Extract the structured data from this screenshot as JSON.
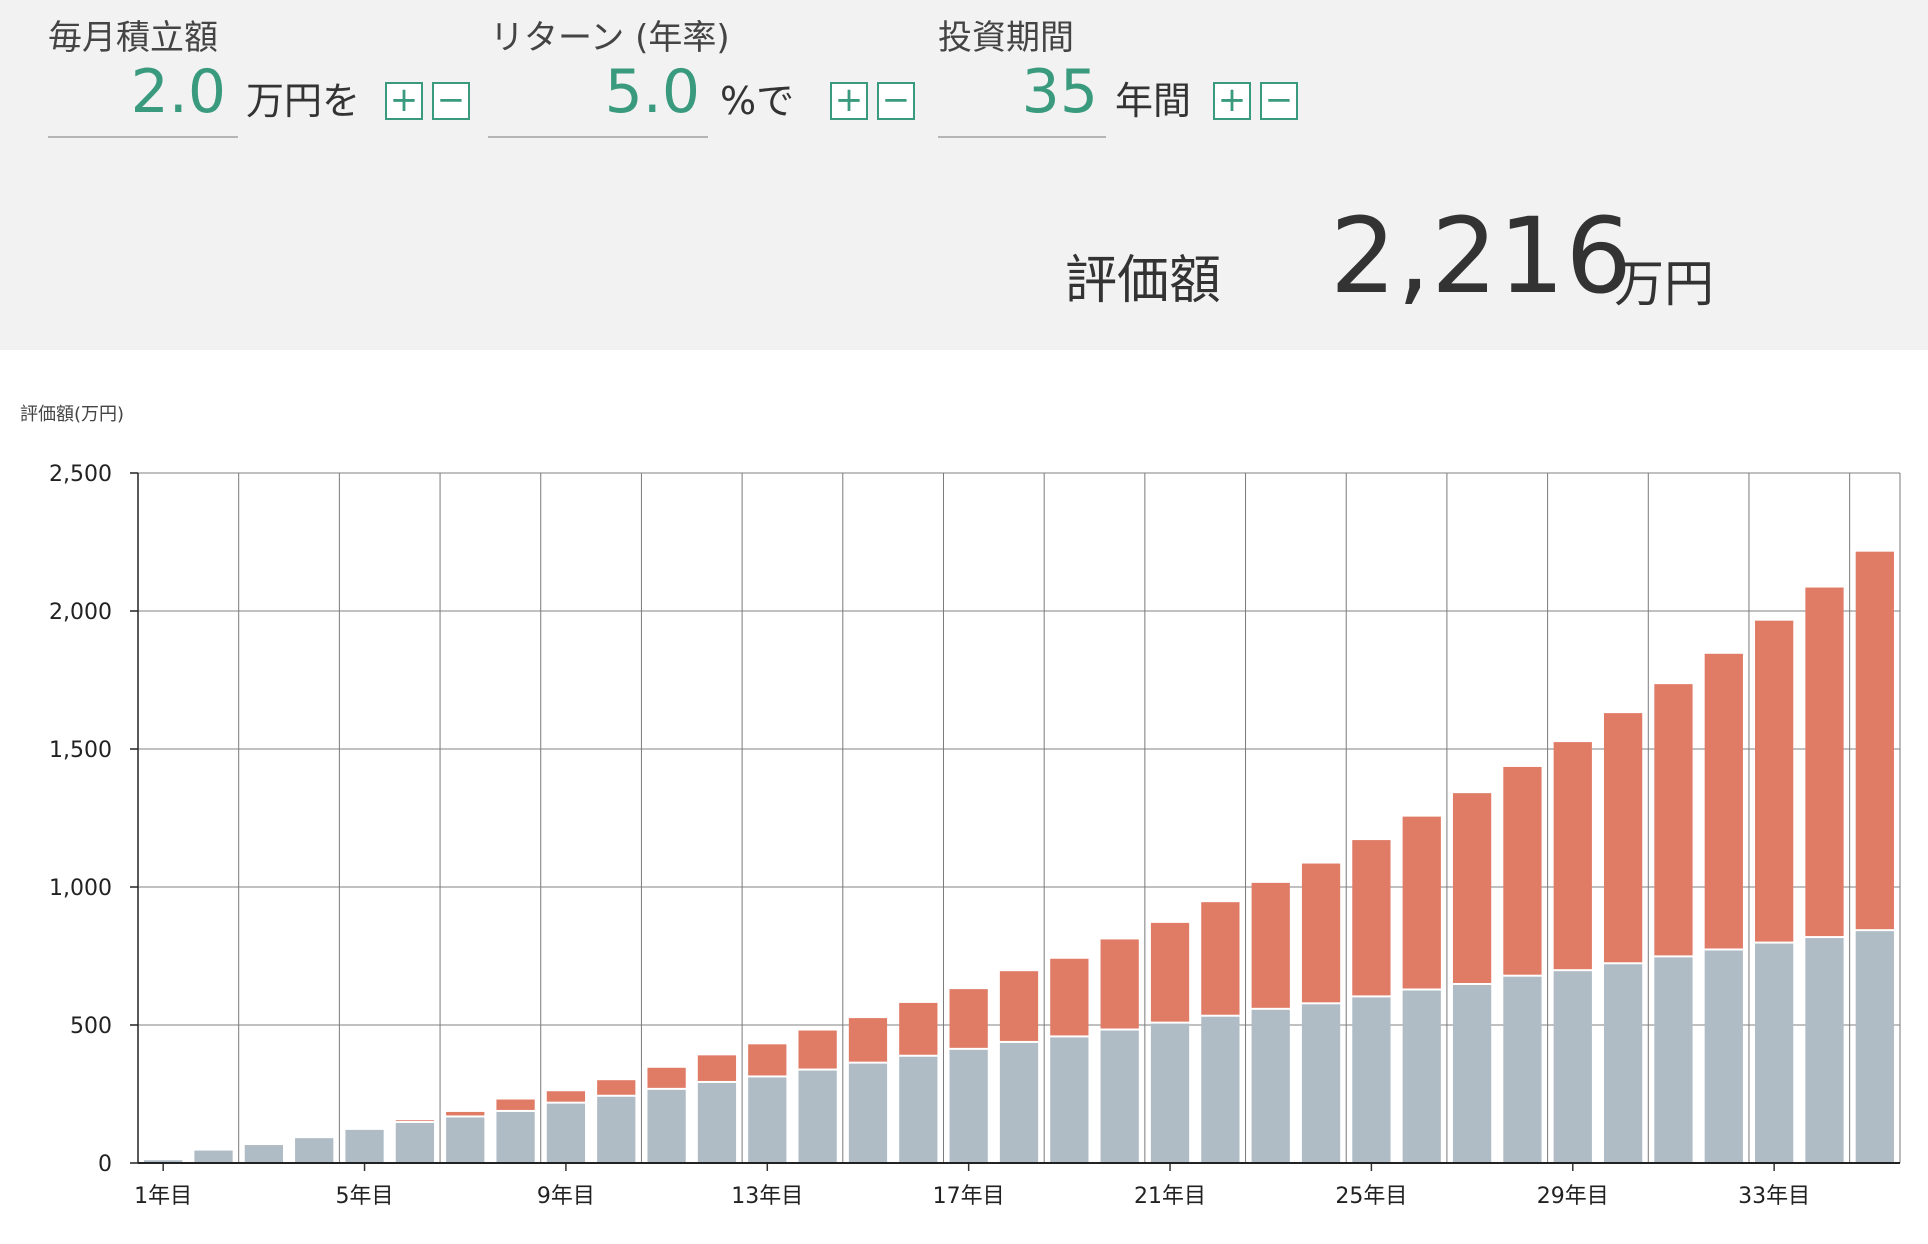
{
  "inputs": [
    {
      "key": "monthly",
      "label": "毎月積立額",
      "value": "2.0",
      "unit": "万円を",
      "plus": "+",
      "minus": "−"
    },
    {
      "key": "rate",
      "label": "リターン (年率)",
      "value": "5.0",
      "unit": "%で",
      "plus": "+",
      "minus": "−"
    },
    {
      "key": "period",
      "label": "投資期間",
      "value": "35",
      "unit": "年間",
      "plus": "+",
      "minus": "−"
    }
  ],
  "result": {
    "label": "評価額",
    "value": "2,216",
    "unit": "万円"
  },
  "colors": {
    "accent": "#3a9a7d",
    "principal": "#afbcc6",
    "gain": "#e07b66"
  },
  "chart_data": {
    "type": "bar",
    "stacked": true,
    "ylabel": "評価額(万円)",
    "ylim": [
      0,
      2500
    ],
    "yticks": [
      0,
      500,
      1000,
      1500,
      2000,
      2500
    ],
    "ytick_labels": [
      "0",
      "500",
      "1,000",
      "1,500",
      "2,000",
      "2,500"
    ],
    "grid": true,
    "categories": [
      "1年目",
      "2年目",
      "3年目",
      "4年目",
      "5年目",
      "6年目",
      "7年目",
      "8年目",
      "9年目",
      "10年目",
      "11年目",
      "12年目",
      "13年目",
      "14年目",
      "15年目",
      "16年目",
      "17年目",
      "18年目",
      "19年目",
      "20年目",
      "21年目",
      "22年目",
      "23年目",
      "24年目",
      "25年目",
      "26年目",
      "27年目",
      "28年目",
      "29年目",
      "30年目",
      "31年目",
      "32年目",
      "33年目",
      "34年目",
      "35年目"
    ],
    "xtick_labels": [
      "1年目",
      "",
      "",
      "",
      "5年目",
      "",
      "",
      "",
      "9年目",
      "",
      "",
      "",
      "13年目",
      "",
      "",
      "",
      "17年目",
      "",
      "",
      "",
      "21年目",
      "",
      "",
      "",
      "25年目",
      "",
      "",
      "",
      "29年目",
      "",
      "",
      "",
      "33年目",
      "",
      ""
    ],
    "series": [
      {
        "values": [
          10,
          45,
          65,
          90,
          120,
          145,
          165,
          185,
          215,
          240,
          265,
          290,
          310,
          335,
          360,
          385,
          410,
          435,
          455,
          480,
          505,
          530,
          555,
          575,
          600,
          625,
          645,
          675,
          695,
          720,
          745,
          770,
          795,
          815,
          840
        ]
      },
      {
        "values": [
          0,
          0,
          0,
          0,
          5,
          10,
          20,
          45,
          45,
          60,
          80,
          100,
          120,
          145,
          165,
          195,
          220,
          260,
          285,
          330,
          365,
          415,
          460,
          510,
          570,
          630,
          695,
          760,
          830,
          910,
          990,
          1075,
          1170,
          1270,
          1375
        ]
      }
    ]
  }
}
